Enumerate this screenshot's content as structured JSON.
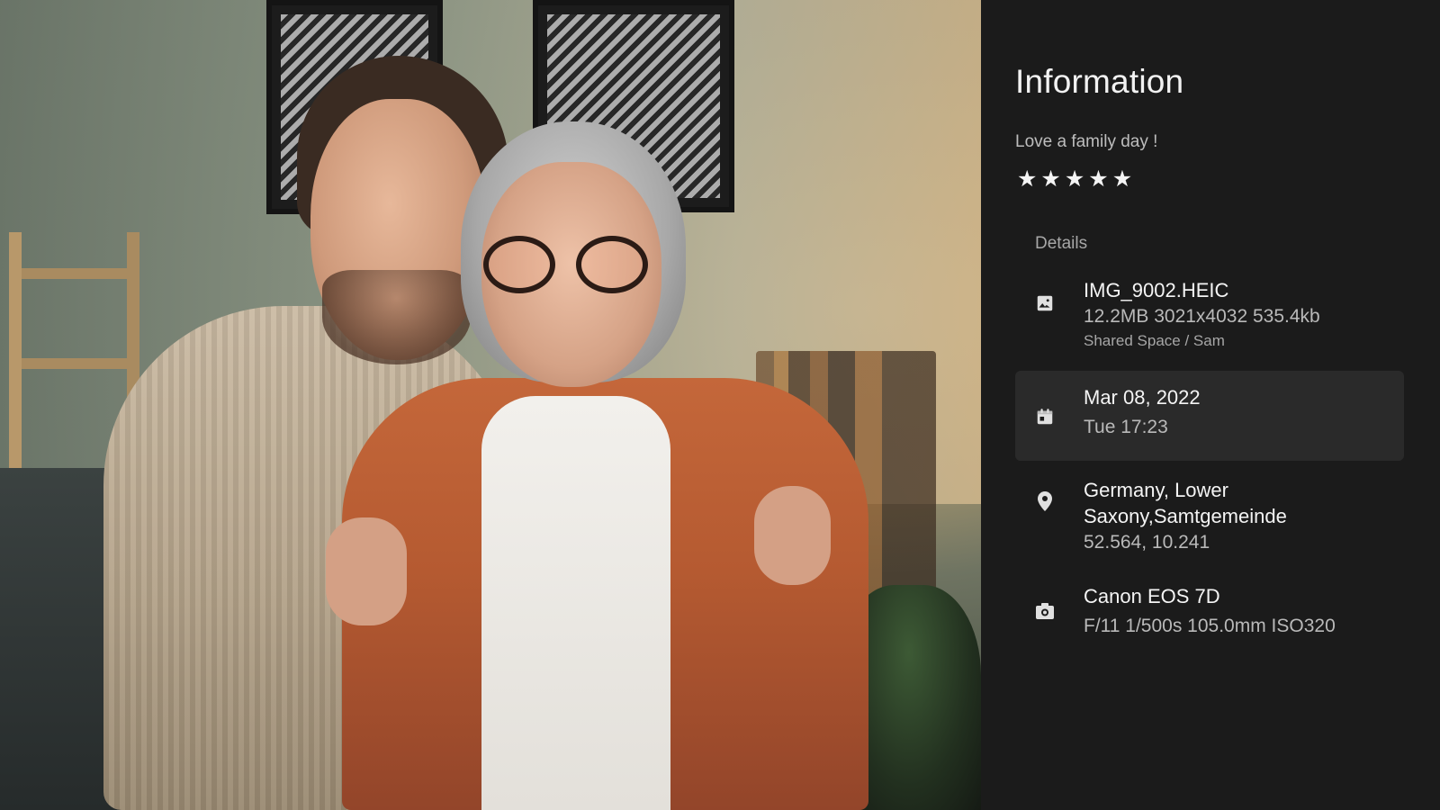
{
  "panel": {
    "title": "Information",
    "caption": "Love a family day !",
    "rating": 5,
    "stars": [
      "★",
      "★",
      "★",
      "★",
      "★"
    ],
    "details_label": "Details"
  },
  "details": {
    "file": {
      "icon": "image-icon",
      "name": "IMG_9002.HEIC",
      "meta": "12.2MB 3021x4032 535.4kb",
      "location": "Shared Space / Sam"
    },
    "date": {
      "icon": "calendar-icon",
      "date": "Mar 08, 2022",
      "time": "Tue 17:23"
    },
    "place": {
      "icon": "location-pin-icon",
      "line1": "Germany, Lower",
      "line2": "Saxony,Samtgemeinde",
      "coords": "52.564, 10.241"
    },
    "camera": {
      "icon": "camera-icon",
      "model": "Canon EOS 7D",
      "settings": "F/11 1/500s 105.0mm ISO320"
    }
  },
  "colors": {
    "panel_bg": "#1b1b1b",
    "highlight_bg": "#2a2a2a",
    "text_primary": "#f4f4f4",
    "text_secondary": "#b9b9b9"
  }
}
